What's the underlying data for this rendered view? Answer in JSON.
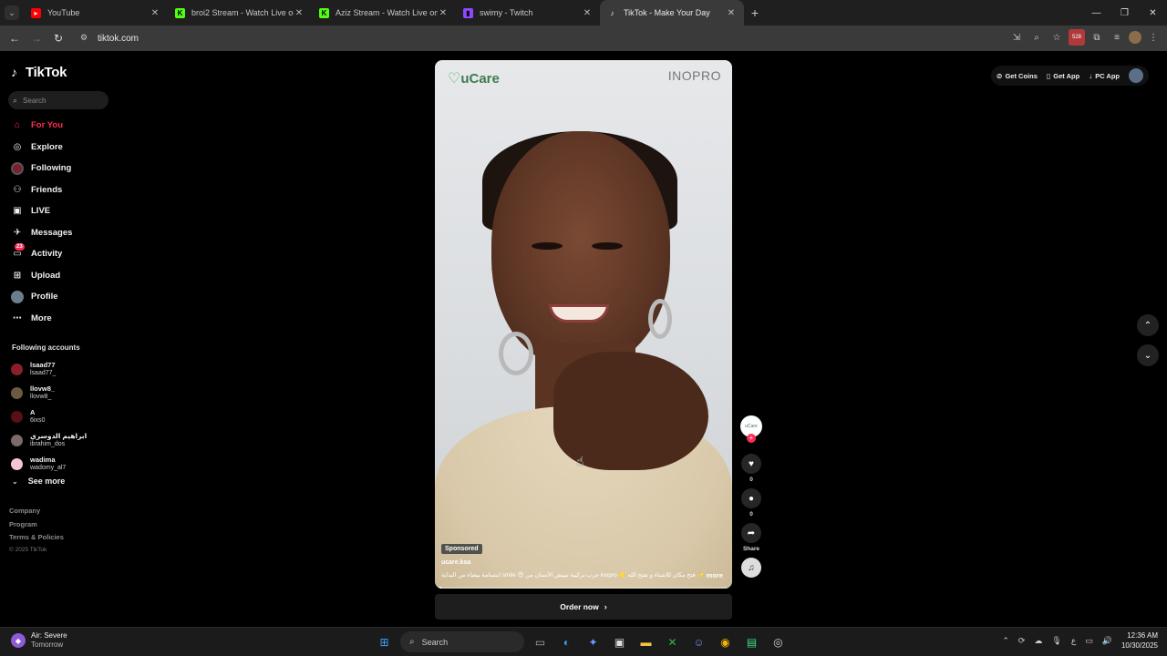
{
  "browser": {
    "tabs": [
      {
        "title": "YouTube",
        "favicon": "youtube-icon",
        "color": "#ff0000",
        "active": false
      },
      {
        "title": "broi2 Stream - Watch Live on K",
        "favicon": "kick-icon",
        "color": "#53fc18",
        "active": false
      },
      {
        "title": "Aziz Stream - Watch Live on Ki",
        "favicon": "kick-icon",
        "color": "#53fc18",
        "active": false
      },
      {
        "title": "swimy - Twitch",
        "favicon": "twitch-icon",
        "color": "#9146ff",
        "active": false
      },
      {
        "title": "TikTok - Make Your Day",
        "favicon": "tiktok-icon",
        "color": "#ffffff",
        "active": true
      }
    ],
    "url": "tiktok.com",
    "extension_badge": "528"
  },
  "tiktok": {
    "logo_text": "TikTok",
    "search_placeholder": "Search",
    "nav": [
      {
        "label": "For You",
        "icon": "home-icon",
        "active": true
      },
      {
        "label": "Explore",
        "icon": "compass-icon",
        "active": false
      },
      {
        "label": "Following",
        "icon": "following-avatar-icon",
        "active": false
      },
      {
        "label": "Friends",
        "icon": "friends-icon",
        "active": false
      },
      {
        "label": "LIVE",
        "icon": "live-icon",
        "active": false
      },
      {
        "label": "Messages",
        "icon": "messages-icon",
        "active": false
      },
      {
        "label": "Activity",
        "icon": "activity-icon",
        "active": false,
        "badge": "23"
      },
      {
        "label": "Upload",
        "icon": "upload-icon",
        "active": false
      },
      {
        "label": "Profile",
        "icon": "profile-avatar-icon",
        "active": false
      },
      {
        "label": "More",
        "icon": "more-icon",
        "active": false
      }
    ],
    "following_title": "Following accounts",
    "following": [
      {
        "name": "lsaad77",
        "handle": "lsaad77_",
        "color": "#8a1f2a"
      },
      {
        "name": "llovw8_",
        "handle": "llovw8_",
        "color": "#6b5a40"
      },
      {
        "name": "A",
        "handle": "6ixs0",
        "color": "#5a0f14"
      },
      {
        "name": "ابراهيم الدوسري",
        "handle": "ibrahim_dos",
        "color": "#7a6a6a"
      },
      {
        "name": "wadima",
        "handle": "wadomy_al7",
        "color": "#f3c5cf"
      }
    ],
    "see_more": "See more",
    "footer": [
      "Company",
      "Program",
      "Terms & Policies"
    ],
    "copyright": "© 2025 TikTok",
    "header_links": [
      {
        "label": "Get Coins",
        "icon": "coin-icon"
      },
      {
        "label": "Get App",
        "icon": "phone-icon"
      },
      {
        "label": "PC App",
        "icon": "download-icon"
      }
    ],
    "video": {
      "brand_left": "uCare",
      "brand_right": "INOPRO",
      "sponsored": "Sponsored",
      "author": "ucare.ksa",
      "caption": "✨ فتح مكان للاشتاء و تفتح الله 🌟 inopro جرب تركيبة تبييض الأسنان من 😍 smile ابتسامة بيضاء من البداية",
      "more": "more",
      "cta": "Order now",
      "progress": 0.02
    },
    "actions": {
      "likes": "0",
      "comments": "0",
      "share": "Share",
      "brand_avatar_text": "uCare"
    }
  },
  "taskbar": {
    "weather_title": "Air: Severe",
    "weather_sub": "Tomorrow",
    "search": "Search",
    "time": "12:36 AM",
    "date": "10/30/2025"
  }
}
